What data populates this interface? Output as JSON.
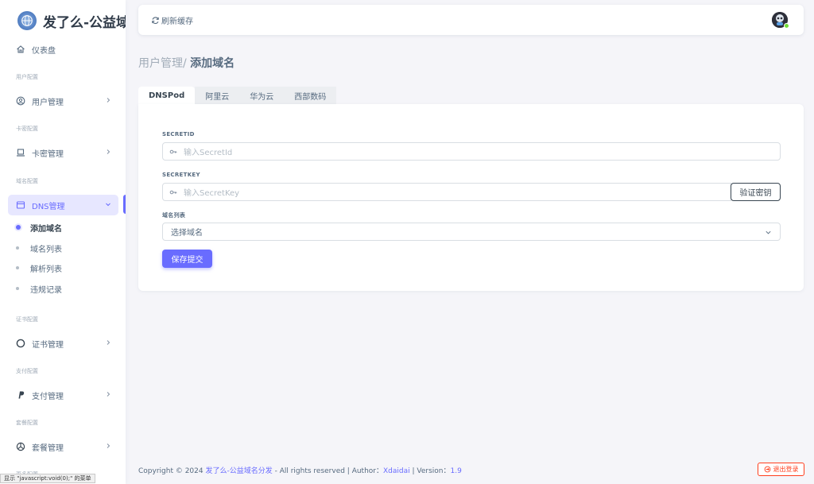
{
  "sidebar": {
    "brand": "发了么-公益域",
    "dashboard": "仪表盘",
    "groups": {
      "user": {
        "header": "用户配置",
        "item": "用户管理"
      },
      "card": {
        "header": "卡密配置",
        "item": "卡密管理"
      },
      "domain": {
        "header": "域名配置",
        "item": "DNS管理"
      },
      "cert": {
        "header": "证书配置",
        "item": "证书管理"
      },
      "pay": {
        "header": "支付配置",
        "item": "支付管理"
      },
      "plan": {
        "header": "套餐配置",
        "item": "套餐管理"
      },
      "more": {
        "header": "更多配置"
      }
    },
    "dns_sub": [
      "添加域名",
      "域名列表",
      "解析列表",
      "违规记录"
    ]
  },
  "status_bar": "显示 \"javascript:void(0);\" 的菜单",
  "navbar": {
    "refresh": "刷新缓存"
  },
  "breadcrumb": {
    "parent": "用户管理/ ",
    "current": "添加域名"
  },
  "tabs": [
    "DNSPod",
    "阿里云",
    "华为云",
    "西部数码"
  ],
  "form": {
    "secretid_label": "SECRETID",
    "secretid_placeholder": "输入SecretId",
    "secretkey_label": "SECRETKEY",
    "secretkey_placeholder": "输入SecretKey",
    "verify_button": "验证密钥",
    "domain_list_label": "域名列表",
    "domain_select_value": "选择域名",
    "save_button": "保存提交"
  },
  "footer": {
    "prefix": "Copyright © 2024 ",
    "site": "发了么-公益域名分发",
    "middle": " - All rights reserved | Author：",
    "author": "Xdaidai",
    "version_prefix": " | Version：",
    "version": "1.9",
    "logout": "退出登录"
  },
  "colors": {
    "primary": "#696cff",
    "danger": "#ff3e1d",
    "online": "#71dd37"
  }
}
